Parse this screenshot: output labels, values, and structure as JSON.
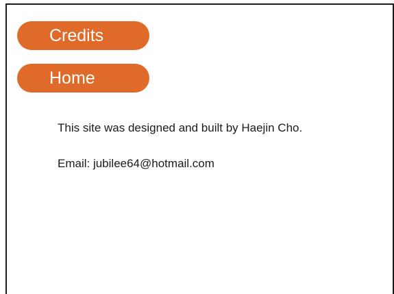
{
  "nav": {
    "items": [
      {
        "label": "Credits"
      },
      {
        "label": "Home"
      }
    ]
  },
  "content": {
    "credit_line": "This site was designed and built by Haejin Cho.",
    "email_line": "Email: jubilee64@hotmail.com"
  },
  "colors": {
    "accent": "#e06a2a",
    "border": "#1a1a1a",
    "text": "#1a1a1a",
    "background": "#ffffff"
  }
}
